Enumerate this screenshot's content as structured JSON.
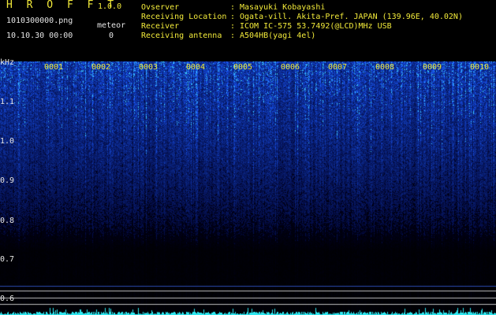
{
  "app": {
    "title": "H R O F F T",
    "version": "1.0.0"
  },
  "file": {
    "name": "1010300000.png",
    "datetime": "10.10.30 00:00"
  },
  "meteor": {
    "label": "meteor",
    "count": "0"
  },
  "info": [
    {
      "label": "Ovserver",
      "colon": ":",
      "value": "Masayuki Kobayashi"
    },
    {
      "label": "Receiving Location",
      "colon": ":",
      "value": "Ogata-vill. Akita-Pref. JAPAN (139.96E, 40.02N)"
    },
    {
      "label": "Receiver",
      "colon": ":",
      "value": "ICOM IC-575 53.7492(@LCD)MHz USB"
    },
    {
      "label": "Receiving antenna",
      "colon": ":",
      "value": "A504HB(yagi 4el)"
    }
  ],
  "axis": {
    "unit": "kHz",
    "ticks": [
      "1.1",
      "1.0",
      "0.9",
      "0.8",
      "0.7",
      "0.6"
    ]
  },
  "frames": [
    "0001",
    "0002",
    "0003",
    "0004",
    "0005",
    "0006",
    "0007",
    "0008",
    "0009",
    "0010"
  ],
  "colors": {
    "label_yellow": "#f2ea3a",
    "text_white": "#e6e6e6",
    "background": "#000000",
    "signal_blue": "#1f4fd8",
    "noise_cyan": "#2ee8f0"
  }
}
